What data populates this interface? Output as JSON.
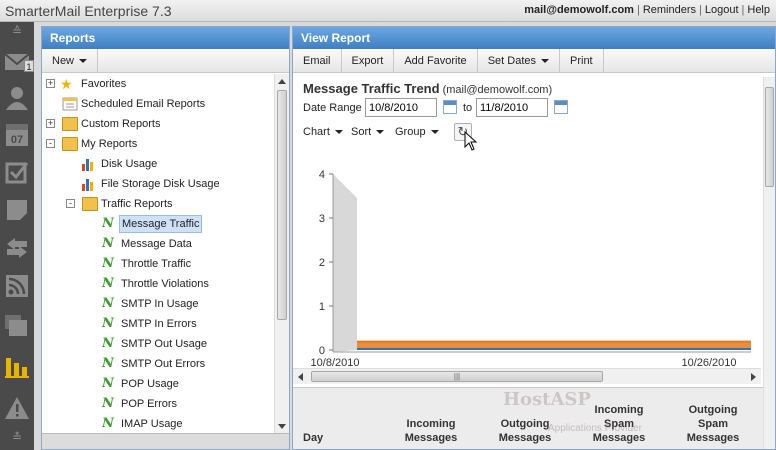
{
  "header": {
    "app_title": "SmarterMail Enterprise 7.3",
    "user": "mail@demowolf.com",
    "links": [
      "Reminders",
      "Logout",
      "Help"
    ]
  },
  "rail": {
    "icons": [
      "chevron-up-icon",
      "mail-icon",
      "contacts-icon",
      "calendar-icon",
      "tasks-icon",
      "notes-icon",
      "sync-icon",
      "rss-icon",
      "folders-icon",
      "reports-icon",
      "alerts-icon",
      "chevron-down-icon"
    ],
    "badge": "1",
    "calendar_day": "07",
    "active": "reports-icon"
  },
  "left_panel": {
    "title": "Reports",
    "new_label": "New",
    "tree": [
      {
        "label": "Favorites",
        "icon": "star-icon",
        "expander": "+"
      },
      {
        "label": "Scheduled Email Reports",
        "icon": "scheduled-report-icon"
      },
      {
        "label": "Custom Reports",
        "icon": "folder-icon",
        "expander": "+"
      },
      {
        "label": "My Reports",
        "icon": "folder-open-icon",
        "expander": "-"
      },
      {
        "label": "Disk Usage",
        "icon": "bar-chart-icon"
      },
      {
        "label": "File Storage Disk Usage",
        "icon": "bar-chart-icon"
      },
      {
        "label": "Traffic Reports",
        "icon": "folder-open-icon",
        "expander": "-"
      },
      {
        "label": "Message Traffic",
        "icon": "line-report-icon",
        "selected": true
      },
      {
        "label": "Message Data",
        "icon": "line-report-icon"
      },
      {
        "label": "Throttle Traffic",
        "icon": "line-report-icon"
      },
      {
        "label": "Throttle Violations",
        "icon": "line-report-icon"
      },
      {
        "label": "SMTP In Usage",
        "icon": "line-report-icon"
      },
      {
        "label": "SMTP In Errors",
        "icon": "line-report-icon"
      },
      {
        "label": "SMTP Out Usage",
        "icon": "line-report-icon"
      },
      {
        "label": "SMTP Out Errors",
        "icon": "line-report-icon"
      },
      {
        "label": "POP Usage",
        "icon": "line-report-icon"
      },
      {
        "label": "POP Errors",
        "icon": "line-report-icon"
      },
      {
        "label": "IMAP Usage",
        "icon": "line-report-icon"
      }
    ]
  },
  "right_panel": {
    "title": "View Report",
    "toolbar": [
      "Email",
      "Export",
      "Add Favorite",
      "Set Dates",
      "Print"
    ],
    "report_title": "Message Traffic Trend",
    "report_account": "(mail@demowolf.com)",
    "date_range_label": "Date Range",
    "date_from": "10/8/2010",
    "to_label": "to",
    "date_to": "11/8/2010",
    "controls": [
      "Chart",
      "Sort",
      "Group"
    ],
    "columns": [
      "Day",
      "Incoming Messages",
      "Outgoing Messages",
      "Incoming Spam Messages",
      "Outgoing Spam Messages"
    ],
    "watermark": "HostASP",
    "watermark_sub": "Applications Provider"
  },
  "chart_data": {
    "type": "area",
    "x_tick_labels": [
      "10/8/2010",
      "10/26/2010"
    ],
    "ylim": [
      0,
      4
    ],
    "y_ticks": [
      0,
      1,
      2,
      3,
      4
    ],
    "grid": false,
    "series": [
      {
        "color": "#e07b1f",
        "values": [
          0.1,
          0.1,
          0.1,
          0.1,
          0.1,
          0.1,
          0.1,
          0.1,
          0.1,
          0.1,
          0.1,
          0.1
        ]
      },
      {
        "color": "#3a6fb5",
        "values": [
          0,
          0,
          0,
          0,
          0,
          0,
          0,
          0,
          0,
          0,
          0,
          0
        ]
      }
    ]
  }
}
